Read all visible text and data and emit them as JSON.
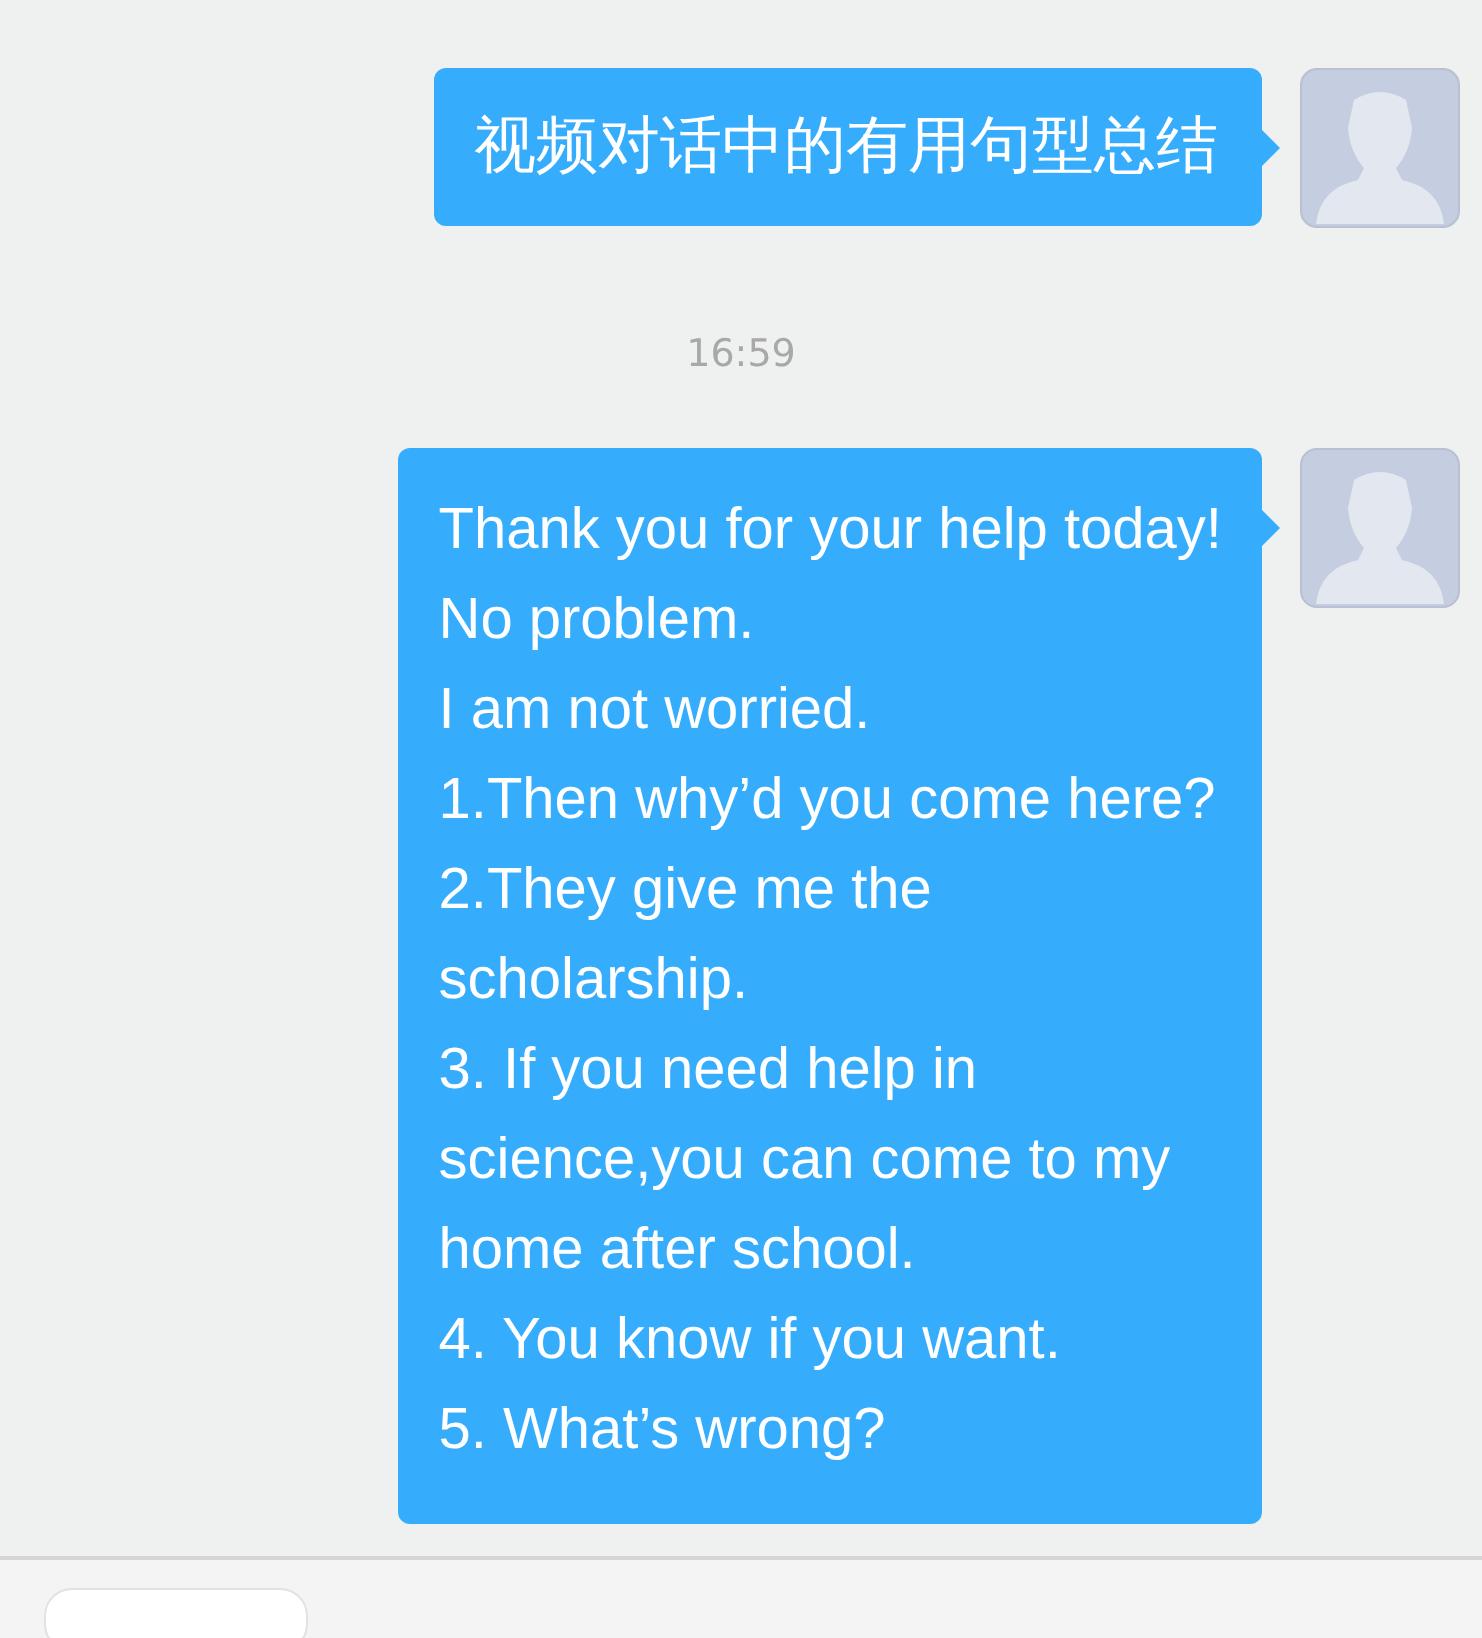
{
  "messages": [
    {
      "kind": "message",
      "lines": [
        "视频对话中的有用句型总结"
      ]
    },
    {
      "kind": "time",
      "text": "16:59"
    },
    {
      "kind": "message",
      "lines": [
        "Thank you for your help today!",
        "No problem.",
        "I am not worried.",
        "1.Then why’d you come here?",
        "2.They give me the",
        "scholarship.",
        "3. If you need help in",
        "science,you can come to my",
        "home after school.",
        "4. You know if you want.",
        "5. What’s wrong?"
      ]
    }
  ]
}
